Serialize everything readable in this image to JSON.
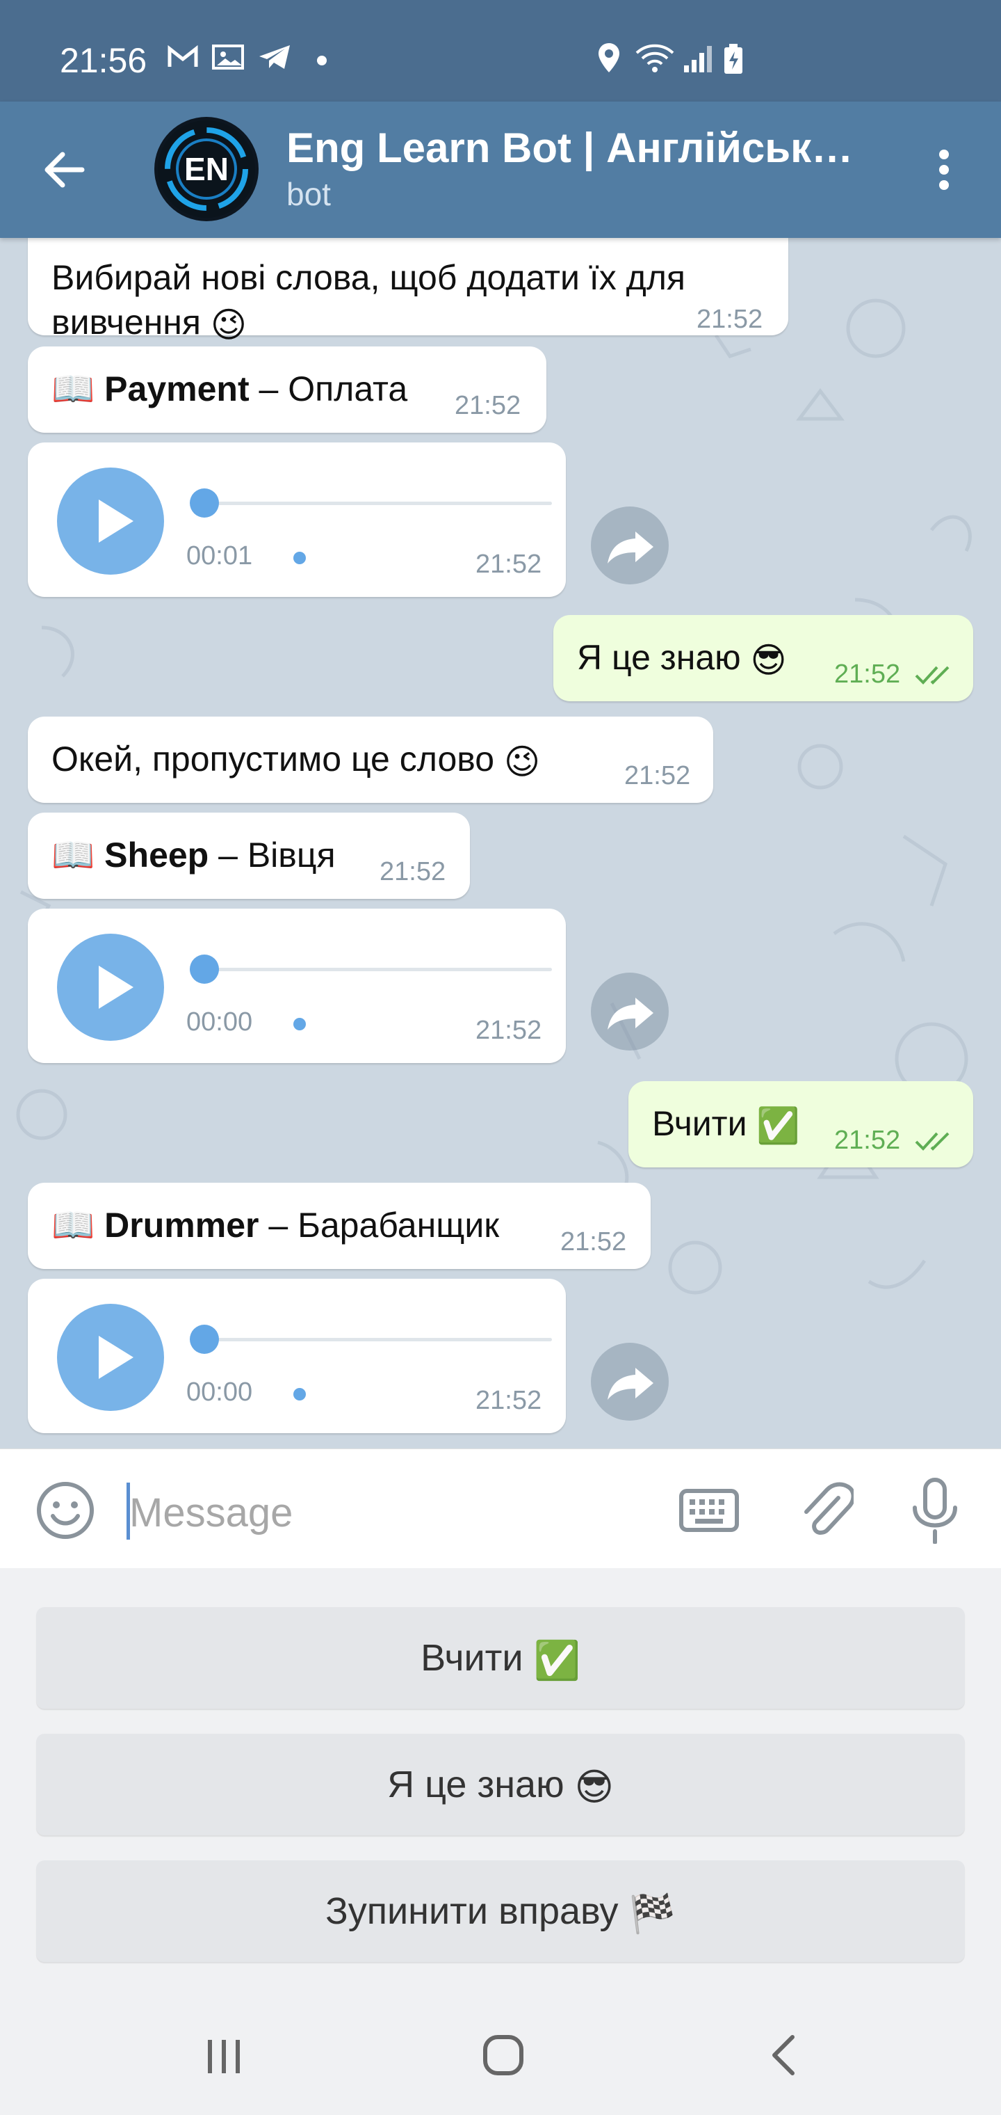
{
  "status_bar": {
    "time": "21:56"
  },
  "header": {
    "title": "Eng Learn Bot | Англійська…",
    "subtitle": "bot",
    "avatar_text": "EN"
  },
  "messages": {
    "m1": {
      "line1": "Вибирай нові слова, щоб додати їх для",
      "line2": "вивчення",
      "time": "21:52"
    },
    "m2": {
      "book": "📖",
      "word": "Payment",
      "dash": " – ",
      "translation": "Оплата",
      "time": "21:52"
    },
    "v1": {
      "duration": "00:01",
      "time": "21:52"
    },
    "m3": {
      "text": "Я це знаю",
      "time": "21:52"
    },
    "m4": {
      "text": "Окей, пропустимо це слово",
      "time": "21:52"
    },
    "m5": {
      "book": "📖",
      "word": "Sheep",
      "dash": " – ",
      "translation": "Вівця",
      "time": "21:52"
    },
    "v2": {
      "duration": "00:00",
      "time": "21:52"
    },
    "m6": {
      "text": "Вчити",
      "time": "21:52"
    },
    "m7": {
      "book": "📖",
      "word": "Drummer",
      "dash": " – ",
      "translation": "Барабанщик",
      "time": "21:52"
    },
    "v3": {
      "duration": "00:00",
      "time": "21:52"
    }
  },
  "input": {
    "placeholder": "Message"
  },
  "keyboard": {
    "learn": "Вчити",
    "know": "Я це знаю",
    "stop": "Зупинити вправу"
  },
  "colors": {
    "header": "#527da3",
    "status_bar": "#4b6d8f",
    "outgoing_bubble": "#effedd",
    "accent": "#78b3e8"
  }
}
